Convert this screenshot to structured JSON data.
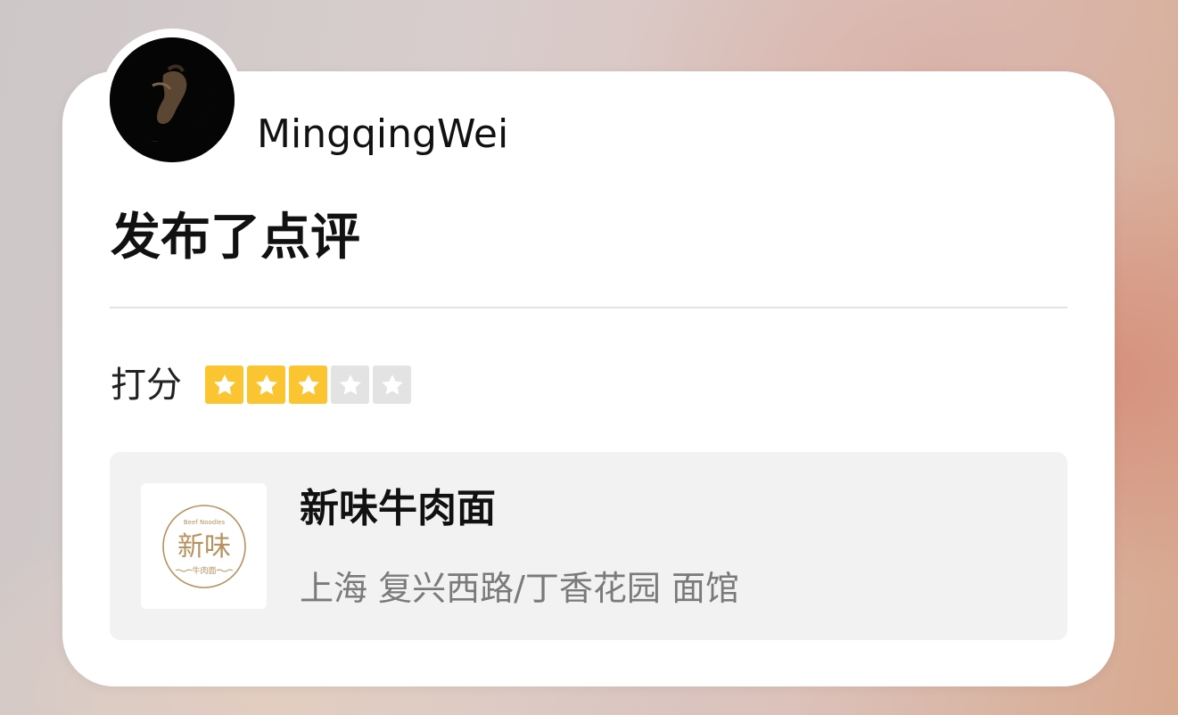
{
  "user": {
    "name": "MingqingWei",
    "avatar_icon": "crescent-moon-avatar"
  },
  "post": {
    "headline": "发布了点评"
  },
  "rating": {
    "label": "打分",
    "value": 3,
    "max": 5,
    "color_on": "#fbc532",
    "color_off": "#e3e3e3"
  },
  "shop": {
    "name": "新味牛肉面",
    "meta": "上海 复兴西路/丁香花园 面馆",
    "logo": {
      "top_text": "Beef Noodles",
      "main_text": "新味",
      "sub_text": "牛肉面",
      "color": "#b8915e"
    }
  }
}
